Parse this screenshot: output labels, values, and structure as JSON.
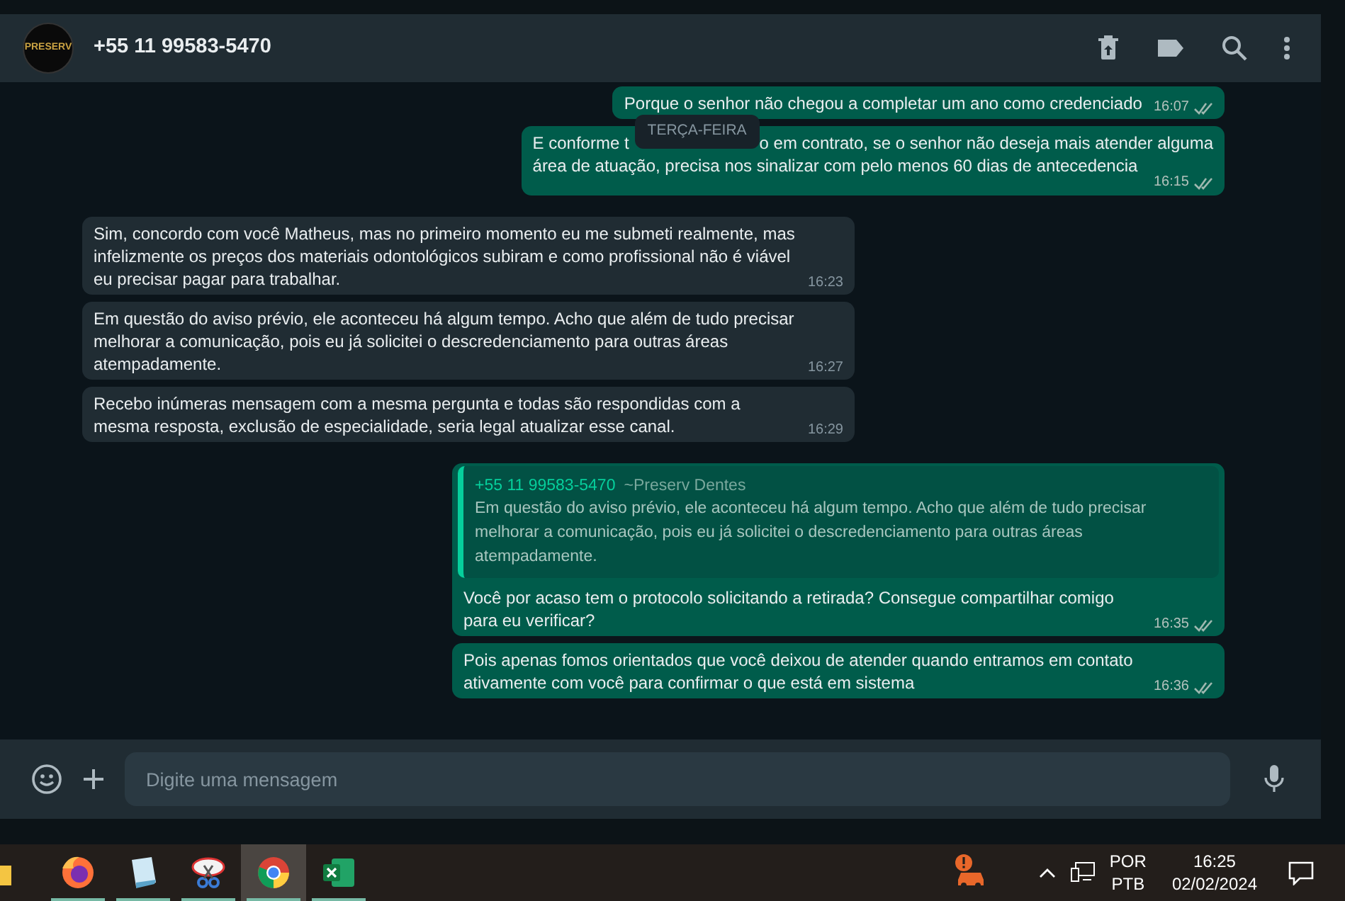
{
  "chat_header": {
    "avatar_logo": "PRESERV",
    "contact": "+55 11 99583-5470"
  },
  "date_chip": "TERÇA-FEIRA",
  "messages": [
    {
      "kind": "text",
      "outgoing": true,
      "text": "Porque o senhor não chegou a completar um ano como credenciado",
      "time": "16:07",
      "read": false
    },
    {
      "kind": "covered",
      "outgoing": true,
      "text_parts": [
        "E conforme t",
        "o em contrato, se o senhor não deseja mais atender  alguma",
        "área de atuação, precisa nos sinalizar com pelo menos 60 dias de antecedencia"
      ],
      "time": "16:15",
      "read": false
    },
    {
      "kind": "text",
      "outgoing": false,
      "text": "Sim, concordo com você Matheus, mas no primeiro momento eu me submeti realmente, mas infelizmente os preços dos materiais odontológicos subiram e como profissional não é viável eu precisar pagar para trabalhar.",
      "time": "16:23"
    },
    {
      "kind": "text",
      "outgoing": false,
      "text": "Em questão do aviso prévio, ele aconteceu há algum tempo. Acho que além de tudo precisar melhorar a comunicação, pois eu já solicitei o descredenciamento para outras áreas atempadamente.",
      "time": "16:27"
    },
    {
      "kind": "text",
      "outgoing": false,
      "text": "Recebo inúmeras mensagem com a mesma pergunta e todas são respondidas com a mesma resposta, exclusão de especialidade, seria legal atualizar esse canal.",
      "time": "16:29"
    },
    {
      "kind": "reply",
      "outgoing": true,
      "quote": {
        "author": "+55 11 99583-5470",
        "author_name": "~Preserv Dentes",
        "text": "Em questão do aviso prévio, ele aconteceu há algum tempo. Acho que além de tudo precisar melhorar a comunicação, pois eu já solicitei o descredenciamento para outras áreas atempadamente."
      },
      "text": "Você por acaso tem o protocolo solicitando a retirada? Consegue compartilhar comigo para eu verificar?",
      "time": "16:35",
      "read": false
    },
    {
      "kind": "text",
      "outgoing": true,
      "text": "Pois apenas fomos orientados que você deixou de atender quando entramos em contato ativamente com você para confirmar o que está em sistema",
      "time": "16:36",
      "read": false
    }
  ],
  "composer": {
    "placeholder": "Digite uma mensagem"
  },
  "taskbar": {
    "apps": [
      {
        "kind": "folder",
        "running": false,
        "selected": false
      },
      {
        "kind": "firefox",
        "running": true,
        "selected": false
      },
      {
        "kind": "notepad",
        "running": true,
        "selected": false
      },
      {
        "kind": "snip",
        "running": true,
        "selected": false
      },
      {
        "kind": "chrome",
        "running": true,
        "selected": true
      },
      {
        "kind": "excel",
        "running": true,
        "selected": false
      }
    ],
    "language": [
      "POR",
      "PTB"
    ],
    "time": "16:25",
    "date": "02/02/2024"
  }
}
